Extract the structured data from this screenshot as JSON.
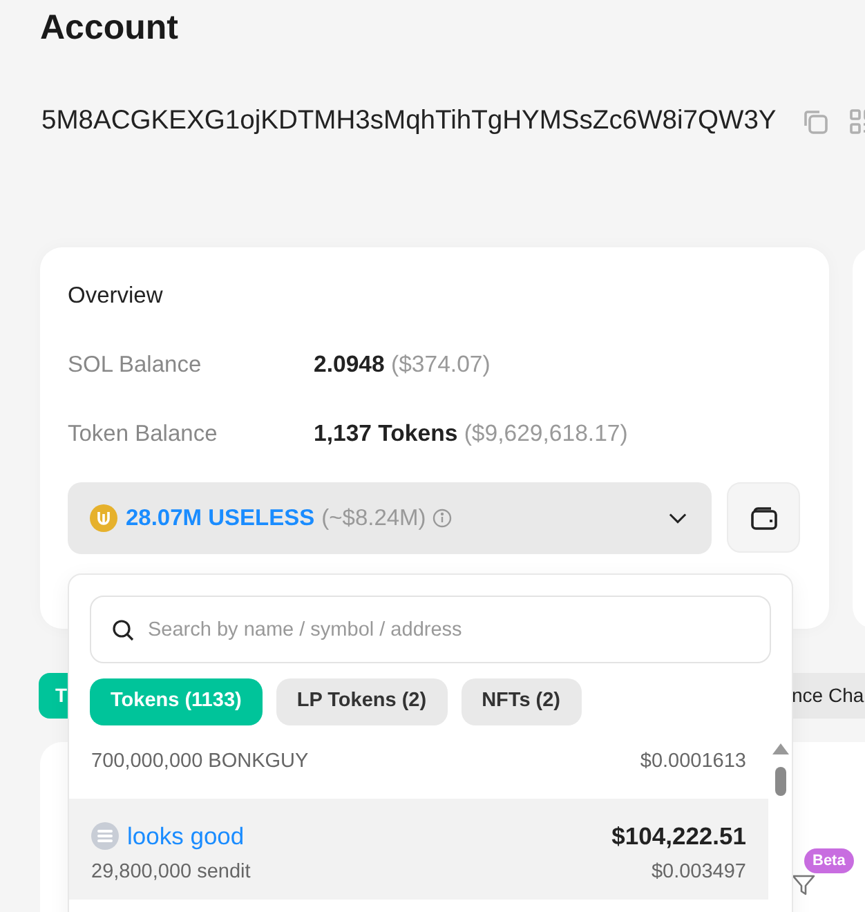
{
  "page": {
    "title": "Account",
    "address": "5M8ACGKEXG1ojKDTMH3sMqhTihTgHYMSsZc6W8i7QW3Y"
  },
  "overview": {
    "title": "Overview",
    "rows": [
      {
        "label": "SOL Balance",
        "value": "2.0948",
        "usd": "($374.07)"
      },
      {
        "label": "Token Balance",
        "value": "1,137 Tokens",
        "usd": "($9,629,618.17)"
      }
    ],
    "token_select": {
      "amount": "28.07M USELESS",
      "approx": "(~$8.24M)",
      "expanded": true,
      "dropdown": {
        "search": {
          "placeholder": "Search by name / symbol / address"
        },
        "tabs": [
          {
            "label": "Tokens (1133)",
            "selected": true
          },
          {
            "label": "LP Tokens (2)",
            "selected": false
          },
          {
            "label": "NFTs (2)",
            "selected": false
          }
        ],
        "tokens": [
          {
            "quantity": "700,000,000 BONKGUY",
            "unit_price": "$0.0001613",
            "highlighted": false
          },
          {
            "name": "looks good",
            "value": "$104,222.51",
            "quantity": "29,800,000 sendit",
            "unit_price": "$0.003497",
            "highlighted": true
          }
        ]
      }
    }
  },
  "section_tabs": [
    {
      "label": "T",
      "selected": true
    },
    {
      "label": "nce Cha",
      "selected": false
    }
  ],
  "filter": {
    "badge": "Beta"
  }
}
